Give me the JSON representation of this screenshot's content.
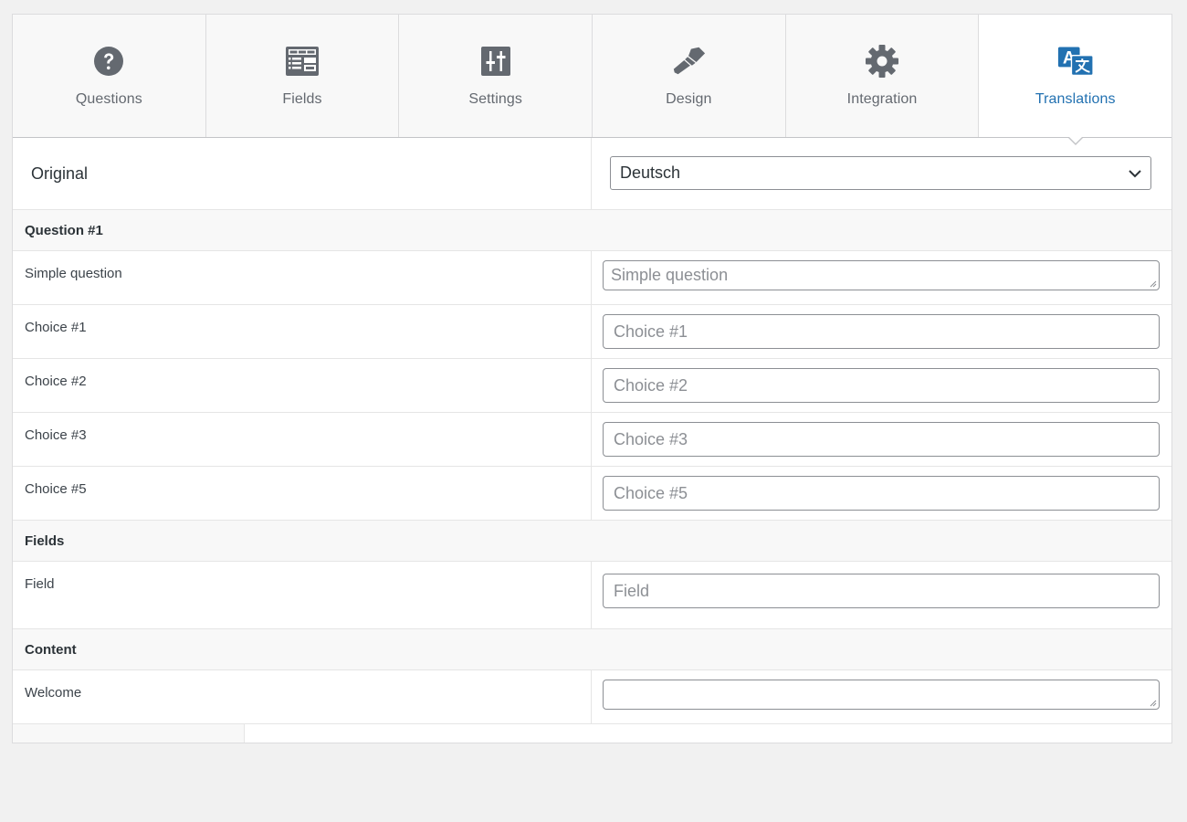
{
  "tabs": [
    {
      "label": "Questions",
      "icon": "question-circle-icon"
    },
    {
      "label": "Fields",
      "icon": "form-fields-icon"
    },
    {
      "label": "Settings",
      "icon": "sliders-icon"
    },
    {
      "label": "Design",
      "icon": "paintbrush-icon"
    },
    {
      "label": "Integration",
      "icon": "gear-icon"
    },
    {
      "label": "Translations",
      "icon": "translate-icon"
    }
  ],
  "active_tab": "Translations",
  "original": {
    "label": "Original",
    "language_selected": "Deutsch"
  },
  "sections": {
    "question": {
      "title": "Question #1",
      "rows": [
        {
          "label": "Simple question",
          "placeholder": "Simple question"
        },
        {
          "label": "Choice #1",
          "placeholder": "Choice #1"
        },
        {
          "label": "Choice #2",
          "placeholder": "Choice #2"
        },
        {
          "label": "Choice #3",
          "placeholder": "Choice #3"
        },
        {
          "label": "Choice #5",
          "placeholder": "Choice #5"
        }
      ]
    },
    "fields": {
      "title": "Fields",
      "rows": [
        {
          "label": "Field",
          "placeholder": "Field"
        }
      ]
    },
    "content": {
      "title": "Content",
      "rows": [
        {
          "label": "Welcome",
          "placeholder": ""
        }
      ]
    }
  },
  "colors": {
    "accent": "#2271b1",
    "icon_gray": "#646970",
    "translate_icon": "#2271b1"
  }
}
